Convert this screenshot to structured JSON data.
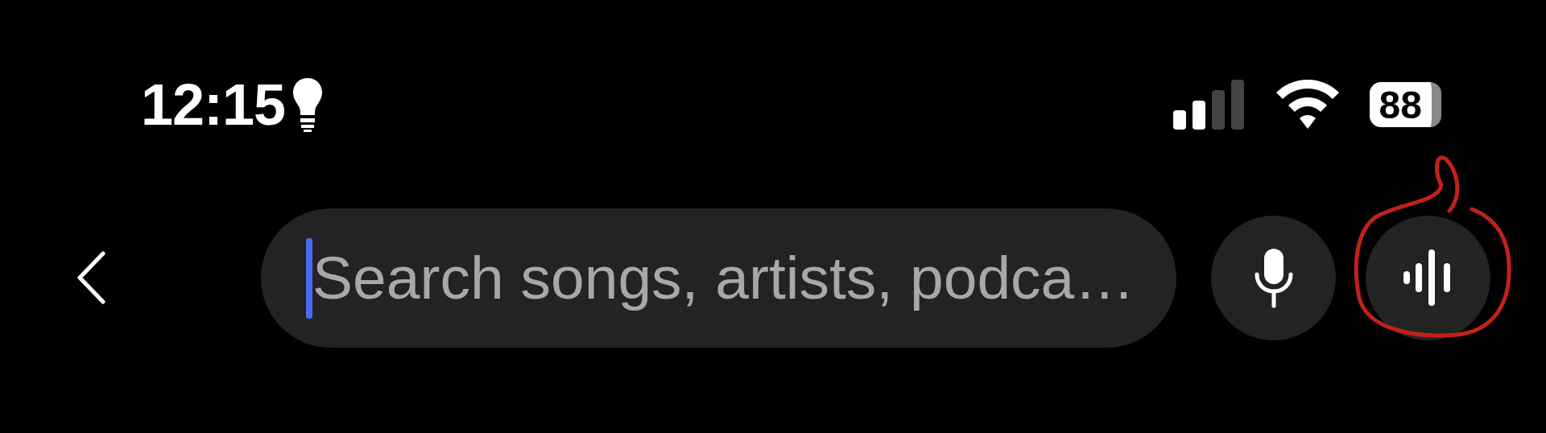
{
  "status_bar": {
    "time": "12:15",
    "battery": "88"
  },
  "search": {
    "placeholder": "Search songs, artists, podca…",
    "focused": true
  }
}
